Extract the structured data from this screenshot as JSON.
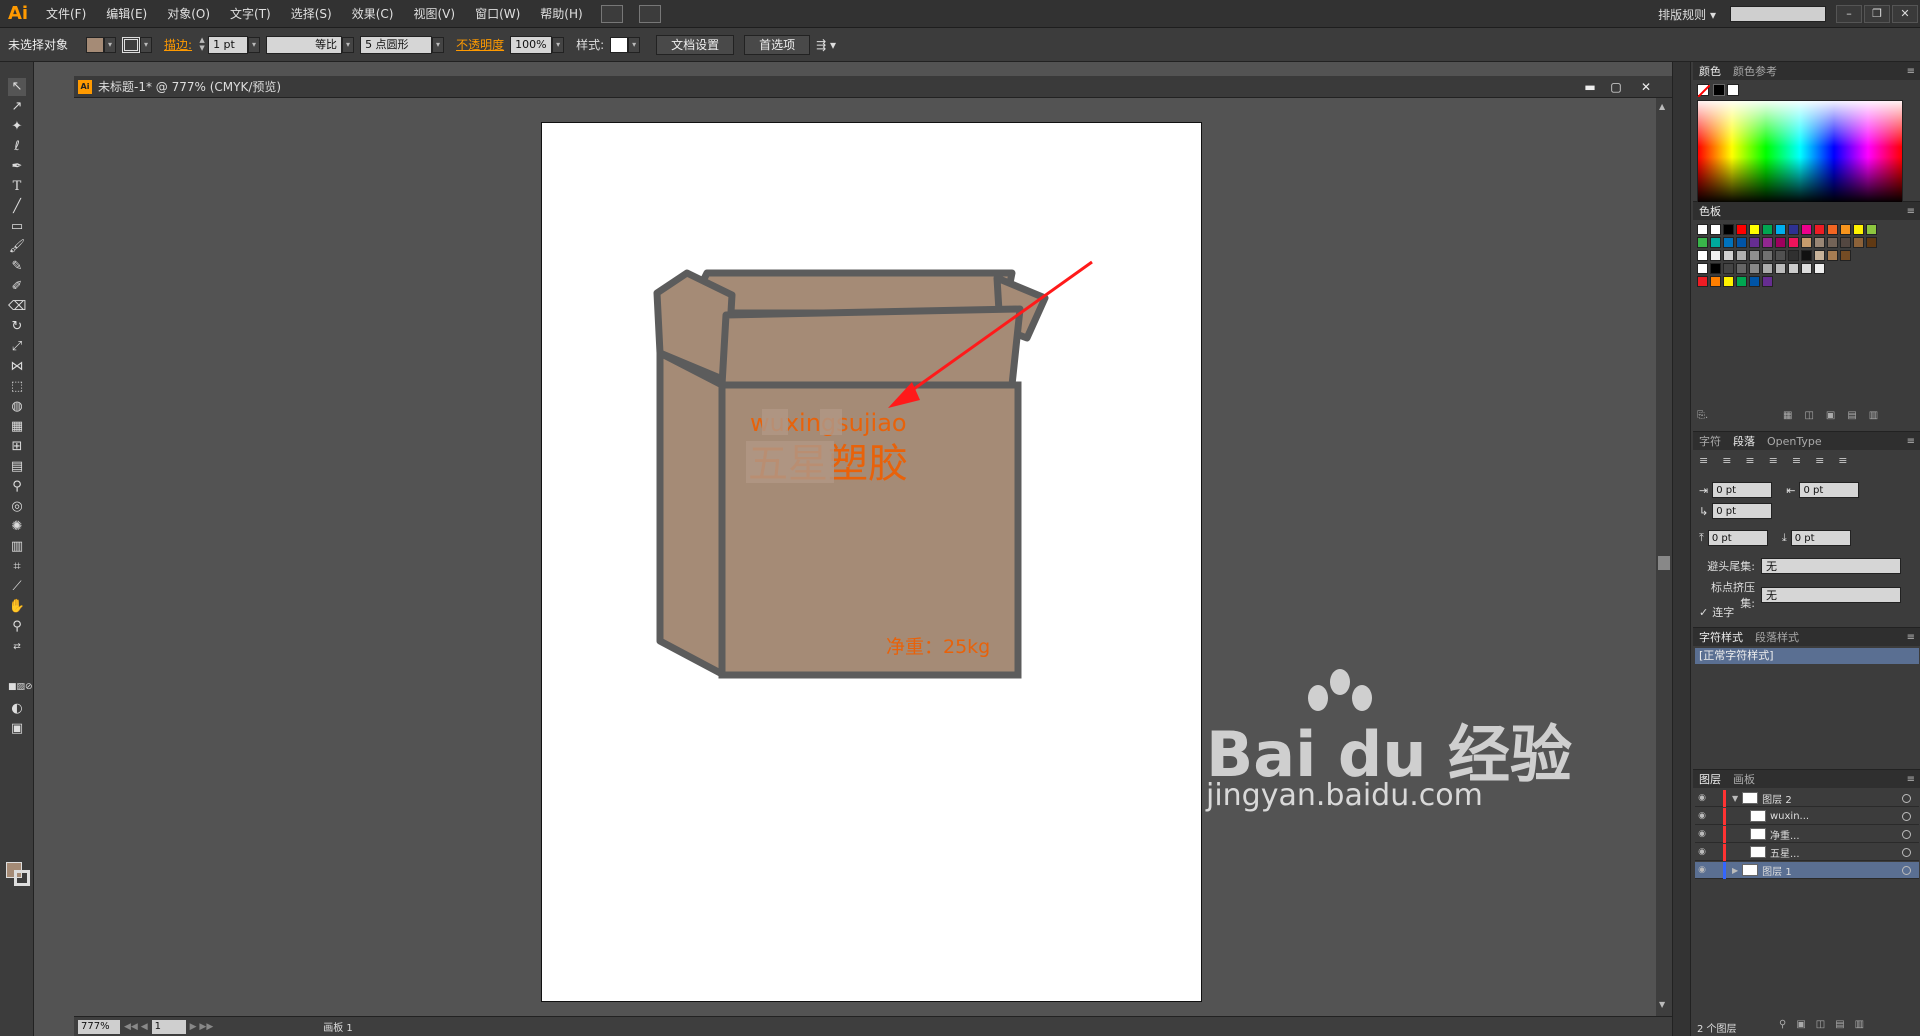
{
  "app": {
    "logo": "Ai",
    "layout_menu": "排版规则 ▾"
  },
  "menu": [
    "文件(F)",
    "编辑(E)",
    "对象(O)",
    "文字(T)",
    "选择(S)",
    "效果(C)",
    "视图(V)",
    "窗口(W)",
    "帮助(H)"
  ],
  "control_bar": {
    "selection_status": "未选择对象",
    "stroke_label": "描边:",
    "stroke_weight": "1 pt",
    "stroke_profile": "等比",
    "brush": "5 点圆形",
    "opacity_label": "不透明度",
    "opacity_value": "100%",
    "style_label": "样式:",
    "doc_setup_button": "文档设置",
    "prefs_button": "首选项"
  },
  "colors": {
    "accent": "#ff9a00",
    "box_fill": "#a58b76",
    "box_stroke": "#5c5c5c",
    "text_orange": "#e8620a",
    "arrow_red": "#ff1a1a"
  },
  "document": {
    "title": "未标题-1* @ 777% (CMYK/预览)",
    "zoom": "777%",
    "artboard_number": "1",
    "artboard_label": "画板 1"
  },
  "artwork": {
    "pinyin_text": "wuxingsujiao",
    "title_text": "五星塑胶",
    "weight_text": "净重：25kg"
  },
  "panels": {
    "color": {
      "tabs": [
        "颜色",
        "颜色参考"
      ]
    },
    "swatches": {
      "title": "色板"
    },
    "paragraph": {
      "tabs": [
        "字符",
        "段落",
        "OpenType"
      ],
      "indent_left": "0 pt",
      "indent_right": "0 pt",
      "first_line": "0 pt",
      "space_before": "0 pt",
      "space_after": "0 pt",
      "kinsoku_label": "避头尾集:",
      "kinsoku_value": "无",
      "mojikumi_label": "标点挤压集:",
      "mojikumi_value": "无",
      "hyphenate": "连字"
    },
    "char_styles": {
      "tabs": [
        "字符样式",
        "段落样式"
      ],
      "normal": "[正常字符样式]"
    },
    "layers": {
      "tabs": [
        "图层",
        "画板"
      ],
      "rows": [
        "图层 2",
        "wuxin...",
        "净重...",
        "五星...",
        "图层 1"
      ],
      "count": "2 个图层"
    }
  },
  "watermark": {
    "brand": "Bai du 经验",
    "url": "jingyan.baidu.com"
  }
}
